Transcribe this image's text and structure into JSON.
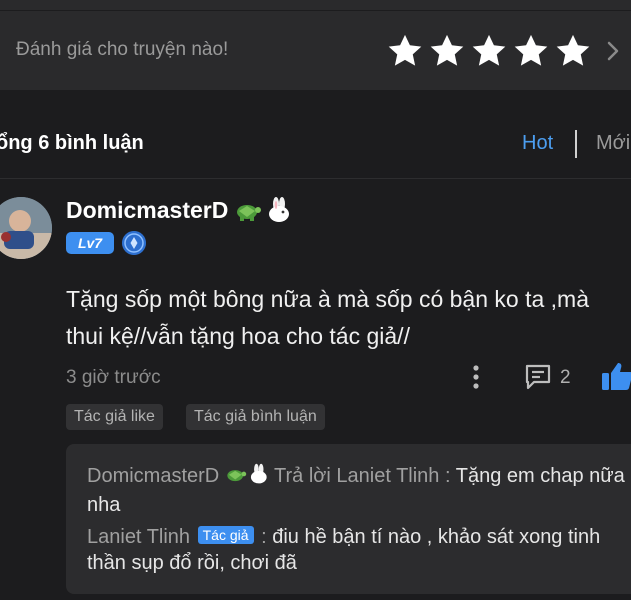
{
  "rating": {
    "prompt": "Đánh giá cho truyện nào!",
    "stars": 5,
    "icon": "chevron-right-icon"
  },
  "comments_header": {
    "count_label": "ổng 6 bình luận",
    "tab_hot": "Hot",
    "tab_new": "Mới",
    "active_tab": "Hot"
  },
  "comment": {
    "username": "DomicmasterD",
    "badges": [
      "turtle-icon",
      "rabbit-icon"
    ],
    "level": "Lv7",
    "text": "Tặng sốp một bông nữa à mà sốp có bận ko ta ,mà thui kệ//vẫn tặng hoa cho tác giả//",
    "time": "3 giờ trước",
    "reply_count": "2",
    "tags": [
      "Tác giả like",
      "Tác giả bình luận"
    ],
    "replies": [
      {
        "name": "DomicmasterD",
        "action": "Trả lời Laniet Tlinh :",
        "text": "Tặng em chap nữa nha"
      },
      {
        "name": "Laniet Tlinh",
        "author_tag": "Tác giả",
        "separator": ":",
        "text": "điu hề bận tí nào , khảo sát xong tinh thần sụp đổ rồi, chơi đã"
      }
    ]
  },
  "colors": {
    "accent": "#3d8ff0",
    "background": "#1c1c1e",
    "star": "#ffffff"
  }
}
